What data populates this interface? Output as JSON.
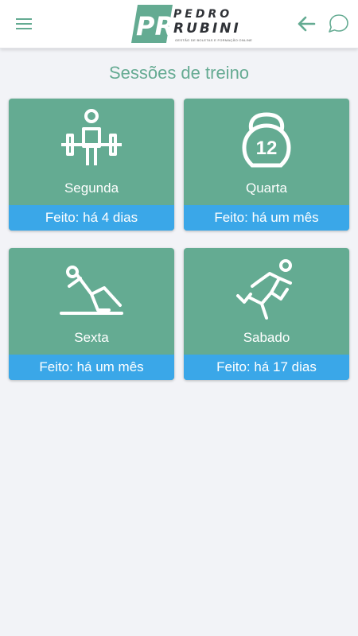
{
  "header": {
    "menu_icon": "hamburger-menu-icon",
    "back_icon": "arrow-left-icon",
    "chat_icon": "chat-bubble-icon",
    "logo": {
      "monogram": "PR",
      "first_name": "PEDRO",
      "last_name": "RUBINI",
      "tagline": "GESTÃO DE BOLETAS E FORMAÇÃO ONLINE"
    }
  },
  "page": {
    "title": "Sessões de treino"
  },
  "sessions": [
    {
      "label": "Segunda",
      "status": "Feito: há 4 dias",
      "icon": "weightlifter-icon"
    },
    {
      "label": "Quarta",
      "status": "Feito: há um mês",
      "icon": "kettlebell-12-icon",
      "icon_text": "12"
    },
    {
      "label": "Sexta",
      "status": "Feito: há um mês",
      "icon": "stretching-icon"
    },
    {
      "label": "Sabado",
      "status": "Feito: há 17 dias",
      "icon": "runner-icon"
    }
  ],
  "colors": {
    "accent": "#64ab92",
    "status_bar": "#3aa7e8",
    "background": "#f2f3f7",
    "title": "#66ab93"
  }
}
